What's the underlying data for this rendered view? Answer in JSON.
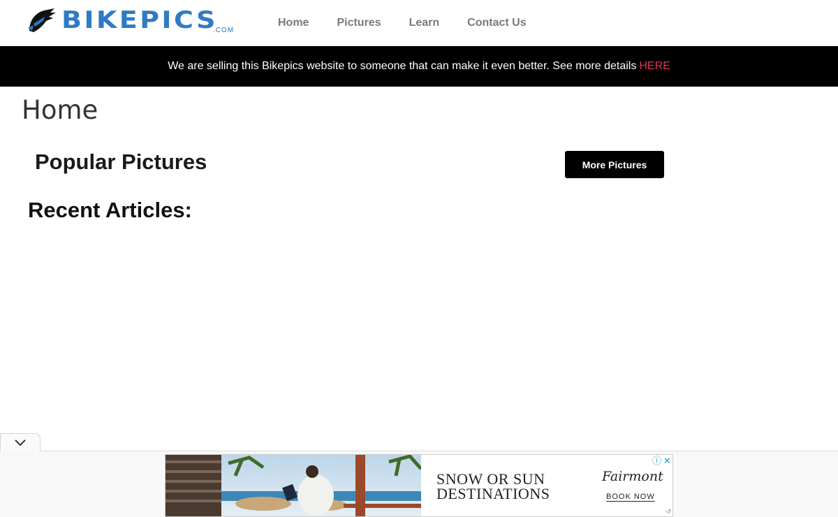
{
  "header": {
    "logo_text": "BIKEPICS",
    "logo_sub": ".COM",
    "nav": [
      {
        "label": "Home"
      },
      {
        "label": "Pictures"
      },
      {
        "label": "Learn"
      },
      {
        "label": "Contact Us"
      }
    ]
  },
  "announcement": {
    "text": "We are selling this Bikepics website to someone that can make it even better. See more details",
    "link_label": "HERE",
    "link_color": "#e0355a"
  },
  "main": {
    "page_title": "Home",
    "popular_title": "Popular Pictures",
    "more_button": "More Pictures",
    "articles_title": "Recent Articles:"
  },
  "ad": {
    "headline_line1": "SNOW OR SUN",
    "headline_line2": "DESTINATIONS",
    "brand": "Fairmont",
    "cta": "BOOK NOW",
    "info_icon": "info-icon",
    "close_icon": "close-icon"
  },
  "colors": {
    "brand_blue": "#2f7bc4",
    "nav_gray": "#7a7a7a",
    "bar_black": "#000000"
  }
}
